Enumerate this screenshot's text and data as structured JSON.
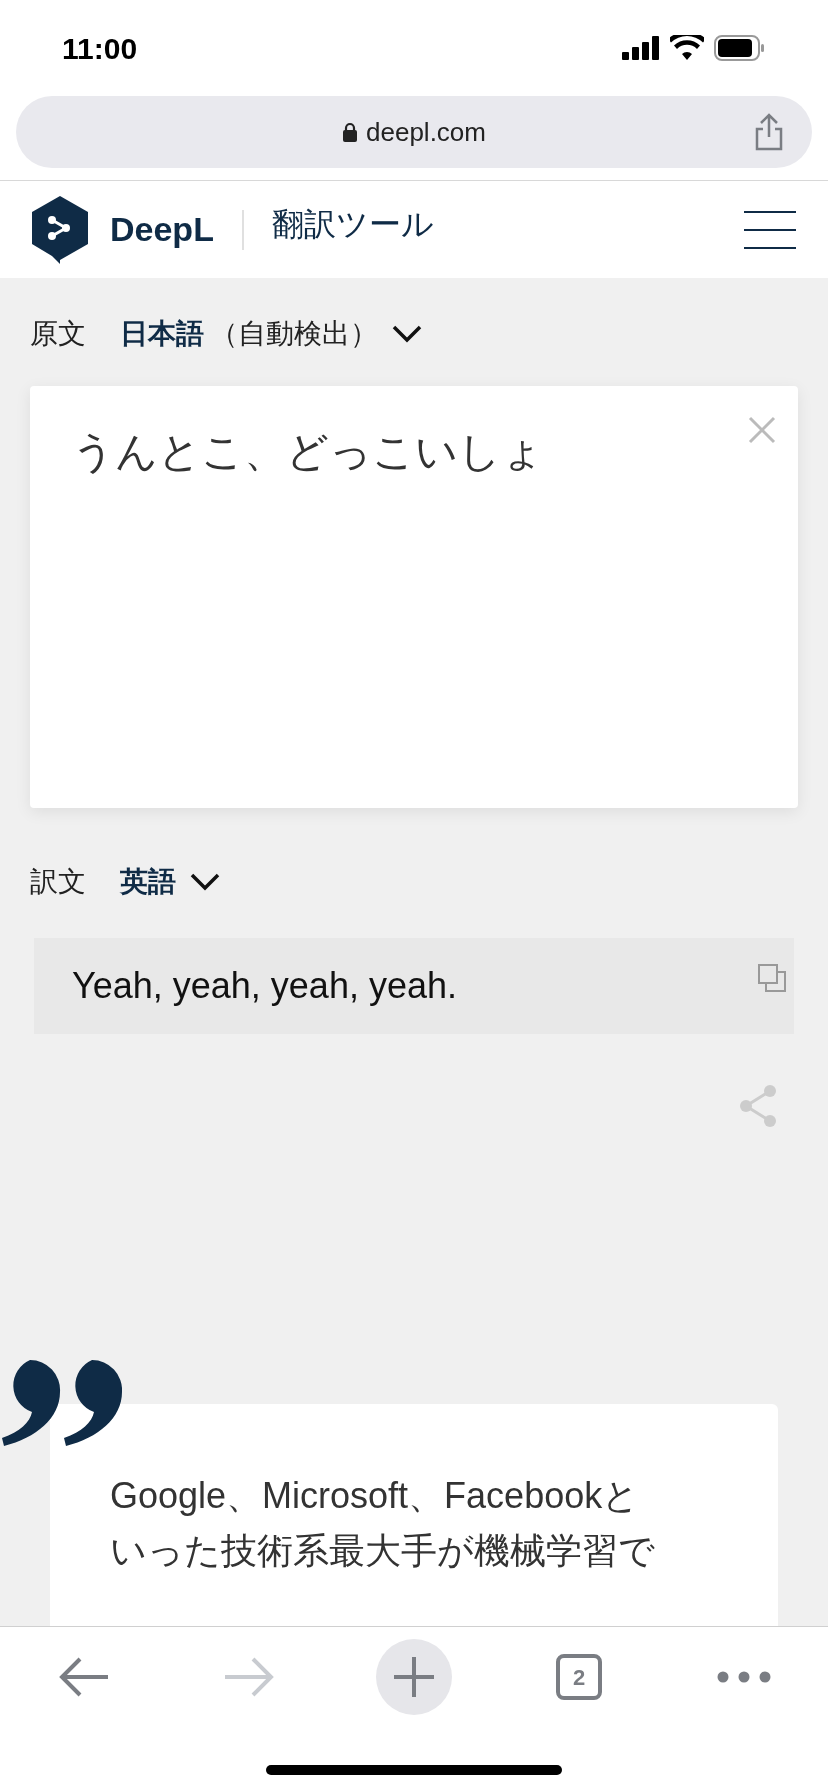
{
  "status_bar": {
    "time": "11:00"
  },
  "browser": {
    "url": "deepl.com"
  },
  "header": {
    "brand": "DeepL",
    "subtitle": "翻訳ツール"
  },
  "source": {
    "label": "原文",
    "language": "日本語",
    "detected": "（自動検出）",
    "text": "うんとこ、どっこいしょ"
  },
  "target": {
    "label": "訳文",
    "language": "英語",
    "text": "Yeah, yeah, yeah, yeah."
  },
  "quote": {
    "lines": [
      "Google、Microsoft、Facebookと",
      "いった技術系最大手が機械学習で"
    ]
  },
  "toolbar": [
    {
      "kind": "back",
      "disabled": false
    },
    {
      "kind": "forward",
      "disabled": true
    },
    {
      "kind": "new-tab",
      "disabled": false
    },
    {
      "kind": "tabs",
      "count": "2",
      "disabled": false
    },
    {
      "kind": "more",
      "disabled": false
    }
  ]
}
